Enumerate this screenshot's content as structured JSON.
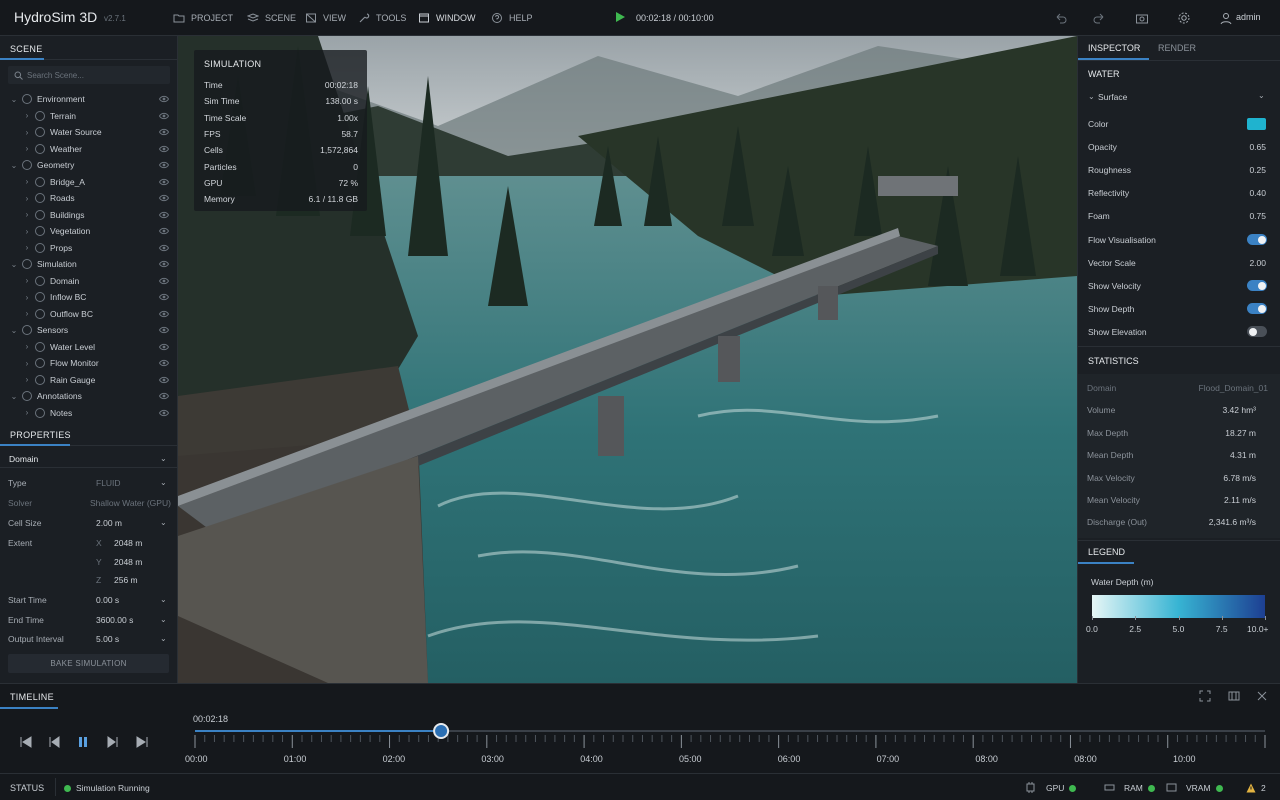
{
  "app": {
    "title": "HydroSim 3D",
    "version": "v2.7.1"
  },
  "menu": [
    {
      "label": "PROJECT",
      "icon": "folder-icon"
    },
    {
      "label": "SCENE",
      "icon": "layers-icon"
    },
    {
      "label": "VIEW",
      "icon": "view-icon"
    },
    {
      "label": "TOOLS",
      "icon": "wrench-icon"
    },
    {
      "label": "WINDOW",
      "icon": "window-icon"
    },
    {
      "label": "HELP",
      "icon": "help-icon"
    }
  ],
  "playback": {
    "time": "00:02:18 / 00:10:00"
  },
  "user": {
    "name": "admin"
  },
  "scene": {
    "title": "SCENE",
    "search_placeholder": "Search Scene...",
    "tree": [
      {
        "label": "Environment",
        "level": 0,
        "expanded": true
      },
      {
        "label": "Terrain",
        "level": 1
      },
      {
        "label": "Water Source",
        "level": 1
      },
      {
        "label": "Weather",
        "level": 1
      },
      {
        "label": "Geometry",
        "level": 0,
        "expanded": true
      },
      {
        "label": "Bridge_A",
        "level": 1
      },
      {
        "label": "Roads",
        "level": 1
      },
      {
        "label": "Buildings",
        "level": 1
      },
      {
        "label": "Vegetation",
        "level": 1
      },
      {
        "label": "Props",
        "level": 1
      },
      {
        "label": "Simulation",
        "level": 0,
        "expanded": true
      },
      {
        "label": "Domain",
        "level": 1
      },
      {
        "label": "Inflow BC",
        "level": 1
      },
      {
        "label": "Outflow BC",
        "level": 1
      },
      {
        "label": "Sensors",
        "level": 0,
        "expanded": true
      },
      {
        "label": "Water Level",
        "level": 1
      },
      {
        "label": "Flow Monitor",
        "level": 1
      },
      {
        "label": "Rain Gauge",
        "level": 1
      },
      {
        "label": "Annotations",
        "level": 0,
        "expanded": true
      },
      {
        "label": "Notes",
        "level": 1
      }
    ]
  },
  "properties": {
    "title": "PROPERTIES",
    "selected": "Domain",
    "type_label": "Type",
    "type_value": "FLUID",
    "solver_label": "Solver",
    "solver_value": "Shallow Water (GPU)",
    "cell_label": "Cell Size",
    "cell_value": "2.00 m",
    "extent_label": "Extent",
    "extent": [
      {
        "axis": "X",
        "value": "2048 m"
      },
      {
        "axis": "Y",
        "value": "2048 m"
      },
      {
        "axis": "Z",
        "value": "256 m"
      }
    ],
    "start_label": "Start Time",
    "start_value": "0.00 s",
    "end_label": "End Time",
    "end_value": "3600.00 s",
    "interval_label": "Output Interval",
    "interval_value": "5.00 s",
    "bake_label": "BAKE SIMULATION"
  },
  "overlay": {
    "title": "SIMULATION",
    "rows": [
      {
        "label": "Time",
        "value": "00:02:18"
      },
      {
        "label": "Sim Time",
        "value": "138.00 s"
      },
      {
        "label": "Time Scale",
        "value": "1.00x"
      },
      {
        "label": "FPS",
        "value": "58.7"
      },
      {
        "label": "Cells",
        "value": "1,572,864"
      },
      {
        "label": "Particles",
        "value": "0"
      },
      {
        "label": "GPU",
        "value": "72 %"
      },
      {
        "label": "Memory",
        "value": "6.1 / 11.8 GB"
      }
    ]
  },
  "inspector": {
    "tabs": [
      "INSPECTOR",
      "RENDER"
    ],
    "section": "WATER",
    "group": "Surface",
    "color_label": "Color",
    "color_hex": "#1fb3cf",
    "sliders": [
      {
        "label": "Opacity",
        "value": "0.65"
      },
      {
        "label": "Roughness",
        "value": "0.25"
      },
      {
        "label": "Reflectivity",
        "value": "0.40"
      },
      {
        "label": "Foam",
        "value": "0.75"
      }
    ],
    "toggles": [
      {
        "label": "Flow Visualisation",
        "on": true
      },
      {
        "label": "Show Velocity",
        "on": true
      },
      {
        "label": "Show Depth",
        "on": true
      },
      {
        "label": "Show Elevation",
        "on": false
      }
    ],
    "vector_label": "Vector Scale",
    "vector_value": "2.00"
  },
  "statistics": {
    "title": "STATISTICS",
    "rows": [
      {
        "label": "Domain",
        "value": "Flood_Domain_01"
      },
      {
        "label": "Volume",
        "value": "3.42 hm³"
      },
      {
        "label": "Max Depth",
        "value": "18.27 m"
      },
      {
        "label": "Mean Depth",
        "value": "4.31 m"
      },
      {
        "label": "Max Velocity",
        "value": "6.78 m/s"
      },
      {
        "label": "Mean Velocity",
        "value": "2.11 m/s"
      },
      {
        "label": "Discharge (Out)",
        "value": "2,341.6 m³/s"
      }
    ]
  },
  "legend": {
    "title": "LEGEND",
    "caption": "Water Depth (m)",
    "ticks": [
      "0.0",
      "2.5",
      "5.0",
      "7.5",
      "10.0+"
    ],
    "colors": [
      "#e6f6f6",
      "#37b4d3",
      "#1d3f92"
    ]
  },
  "timeline": {
    "title": "TIMELINE",
    "current": "00:02:18",
    "progress": 0.23,
    "labels": [
      "00:00",
      "01:00",
      "02:00",
      "03:00",
      "04:00",
      "05:00",
      "06:00",
      "07:00",
      "08:00",
      "08:00",
      "10:00"
    ]
  },
  "status": {
    "title": "STATUS",
    "message": "Simulation Running",
    "gpu": "GPU",
    "ram": "RAM",
    "vram": "VRAM",
    "warnings": "2"
  },
  "colors": {
    "accent": "#3b82c4",
    "ok": "#3fb950",
    "warn": "#e3b341"
  }
}
